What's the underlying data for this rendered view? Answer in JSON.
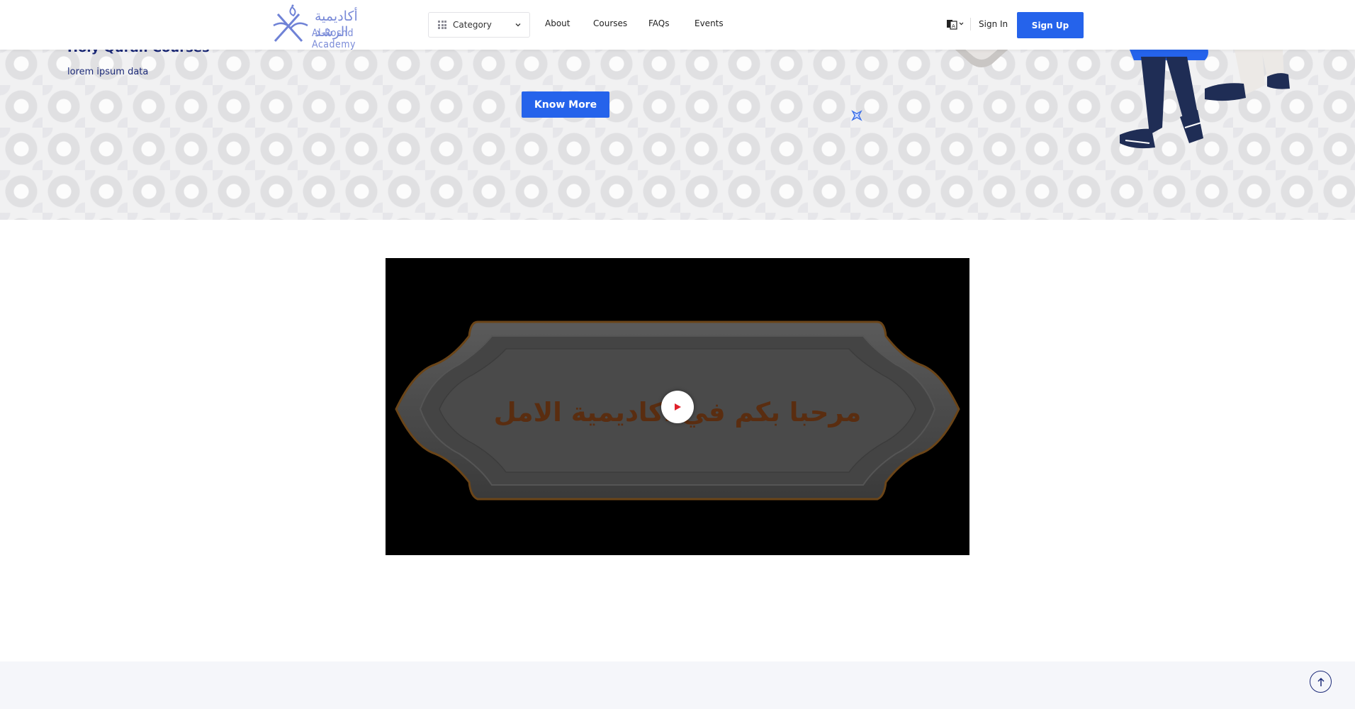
{
  "header": {
    "logo": {
      "arabic": "أكاديمية الرشد",
      "english": "Al-Roshd Academy"
    },
    "category": {
      "label": "Category"
    },
    "nav": [
      {
        "label": "About"
      },
      {
        "label": "Courses"
      },
      {
        "label": "FAQs"
      },
      {
        "label": "Events"
      }
    ],
    "sign_in": "Sign In",
    "sign_up": "Sign Up"
  },
  "hero": {
    "title": "Holy Quran Courses",
    "subtitle": "lorem ipsum data",
    "cta": "Know More"
  },
  "video": {
    "overlay_text": "مرحبا بكم في اكاديمية الامل"
  },
  "colors": {
    "primary": "#2563eb",
    "navy_text": "#1c2a78",
    "hero_bg": "#f1f1f2",
    "footer_bg": "#f5f6fa"
  },
  "icons": {
    "category": "grid-icon",
    "dropdown": "chevron-down-icon",
    "language": "translate-icon",
    "play": "play-icon",
    "scroll_top": "arrow-up-icon"
  }
}
